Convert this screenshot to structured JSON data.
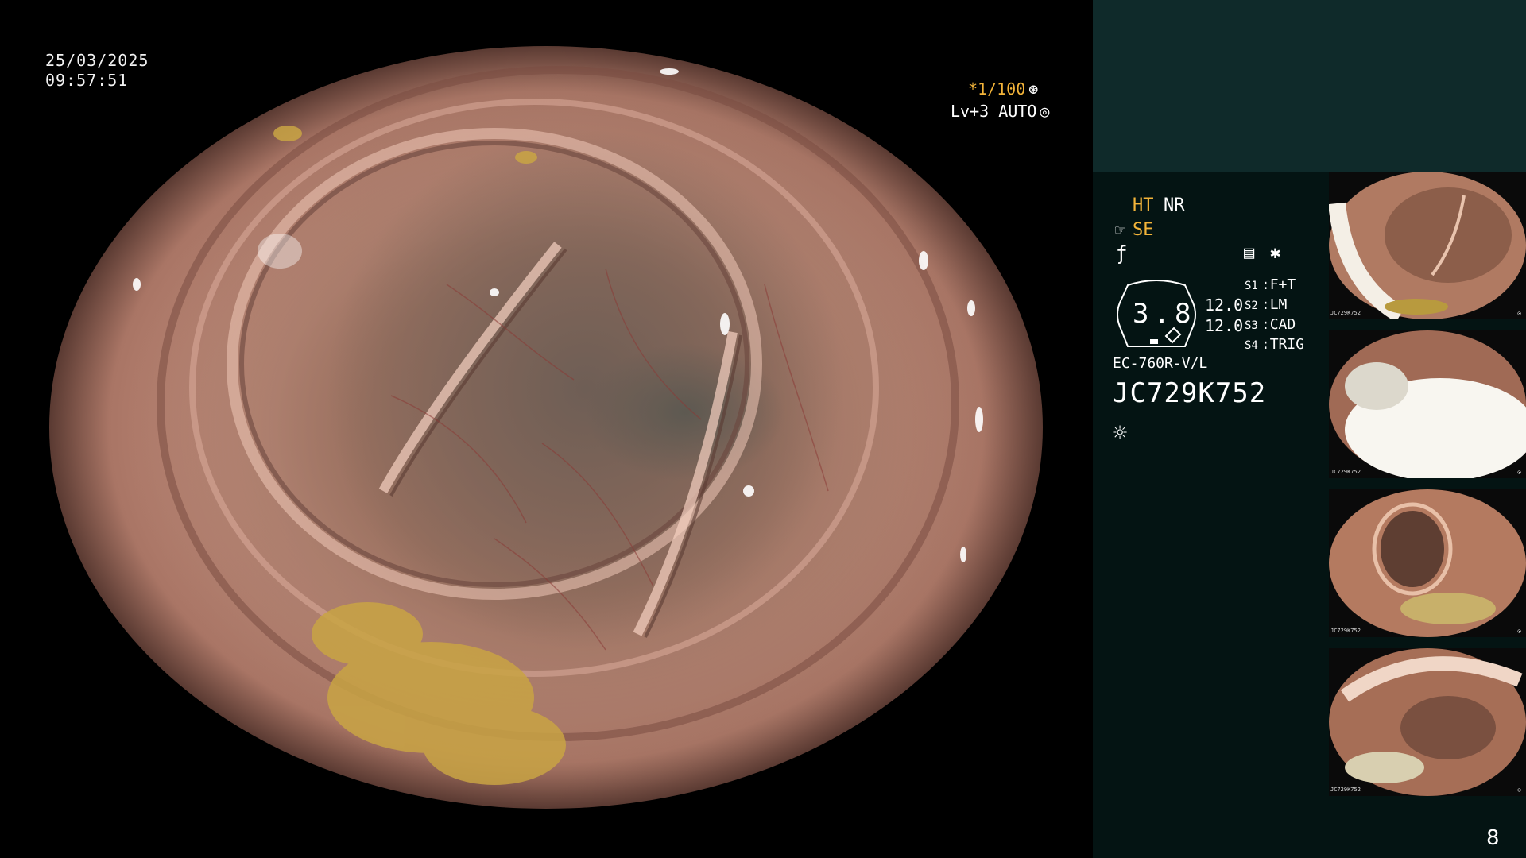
{
  "overlay": {
    "date": "25/03/2025",
    "time": "09:57:51",
    "shutter": "*1/100",
    "shutter_icon": "aperture-icon",
    "level": "Lv+3 AUTO",
    "level_icon": "iris-icon"
  },
  "panel": {
    "ht_label": "HT",
    "nr_label": "NR",
    "se_label": "SE",
    "se_icon": "hand-icon",
    "wave_icon": "f-icon",
    "memo_icon": "memo-icon",
    "star_icon": "asterisk-icon",
    "gauge_value": "3.8",
    "value_1": "12.0",
    "value_2": "12.0",
    "switches": [
      {
        "key": "S1",
        "value": "F+T"
      },
      {
        "key": "S2",
        "value": "LM"
      },
      {
        "key": "S3",
        "value": "CAD"
      },
      {
        "key": "S4",
        "value": "TRIG"
      }
    ],
    "scope_model": "EC-760R-V/L",
    "scope_serial": "JC729K752",
    "light_icon": "sun-icon"
  },
  "thumbnails": [
    {
      "caption": "JC729K752"
    },
    {
      "caption": "JC729K752"
    },
    {
      "caption": "JC729K752"
    },
    {
      "caption": "JC729K752"
    }
  ],
  "page_number": "8",
  "colors": {
    "accent": "#f3b43a",
    "panel_top": "#0f2a2a",
    "panel_bg": "#041413",
    "tissue": "#c99483",
    "lumen": "#5d5951"
  }
}
